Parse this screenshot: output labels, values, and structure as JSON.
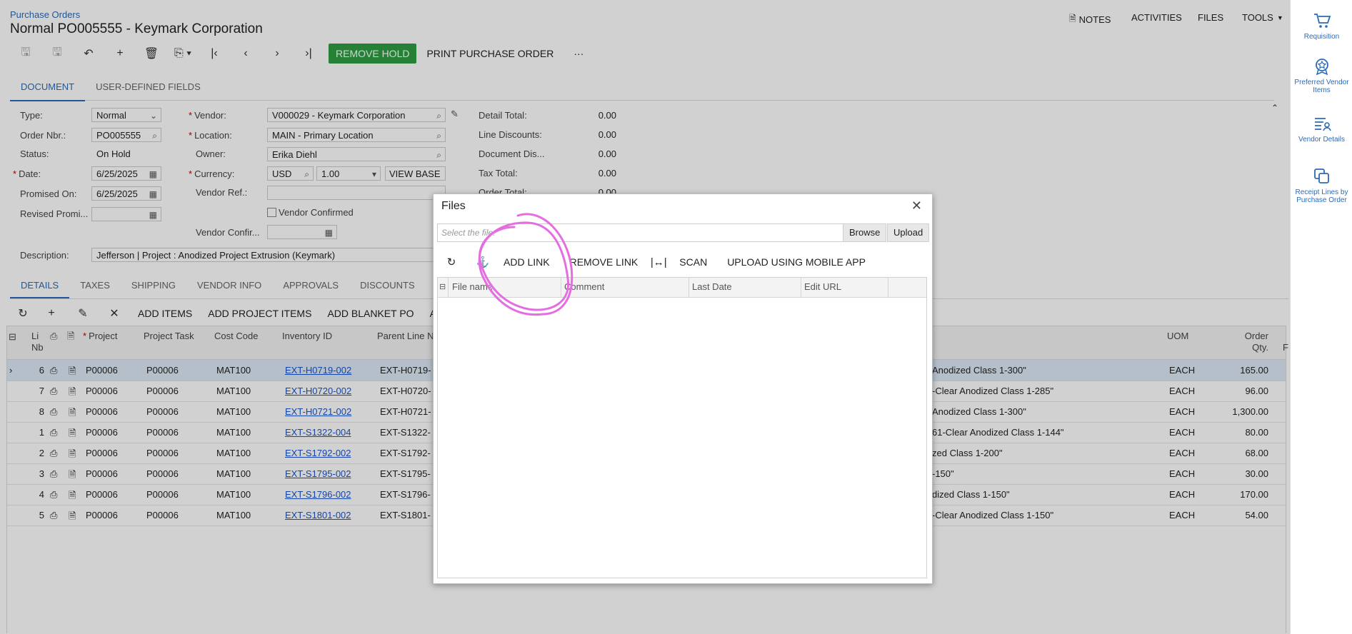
{
  "breadcrumb": "Purchase Orders",
  "title": "Normal PO005555 - Keymark Corporation",
  "top_actions": [
    "NOTES",
    "ACTIVITIES",
    "FILES",
    "TOOLS"
  ],
  "toolbar": {
    "remove_hold": "REMOVE HOLD",
    "print_po": "PRINT PURCHASE ORDER",
    "more": "···"
  },
  "main_tabs": [
    "DOCUMENT",
    "USER-DEFINED FIELDS"
  ],
  "form": {
    "type_label": "Type:",
    "type_value": "Normal",
    "order_label": "Order Nbr.:",
    "order_value": "PO005555",
    "status_label": "Status:",
    "status_value": "On Hold",
    "date_label": "Date:",
    "date_value": "6/25/2025",
    "promised_label": "Promised On:",
    "promised_value": "6/25/2025",
    "revised_label": "Revised Promi...",
    "revised_value": "",
    "vendor_label": "Vendor:",
    "vendor_value": "V000029 - Keymark Corporation",
    "location_label": "Location:",
    "location_value": "MAIN - Primary Location",
    "owner_label": "Owner:",
    "owner_value": "Erika Diehl",
    "currency_label": "Currency:",
    "currency_value": "USD",
    "rate_value": "1.00",
    "view_base": "VIEW BASE",
    "vendor_ref_label": "Vendor Ref.:",
    "vendor_ref_value": "",
    "vendor_confirmed_label": "Vendor Confirmed",
    "vendor_confir_label": "Vendor Confir...",
    "vendor_confir_value": "",
    "description_label": "Description:",
    "description_value": "Jefferson | Project : Anodized Project Extrusion (Keymark)",
    "detail_total_label": "Detail Total:",
    "detail_total_value": "0.00",
    "line_discounts_label": "Line Discounts:",
    "line_discounts_value": "0.00",
    "document_dis_label": "Document Dis...",
    "document_dis_value": "0.00",
    "tax_total_label": "Tax Total:",
    "tax_total_value": "0.00",
    "order_total_label": "Order Total:",
    "order_total_value": "0.00"
  },
  "detail_tabs": [
    "DETAILS",
    "TAXES",
    "SHIPPING",
    "VENDOR INFO",
    "APPROVALS",
    "DISCOUNTS"
  ],
  "grid_toolbar": [
    "ADD ITEMS",
    "ADD PROJECT ITEMS",
    "ADD BLANKET PO",
    "A"
  ],
  "grid_headers": {
    "line": "Li\nNb",
    "project": "Project",
    "task": "Project Task",
    "cost": "Cost Code",
    "inventory": "Inventory ID",
    "parent": "Parent Line N",
    "uom": "UOM",
    "qty": "Order\nQty.",
    "f": "F"
  },
  "rows": [
    {
      "line": "6",
      "project": "P00006",
      "task": "P00006",
      "cost": "MAT100",
      "inv": "EXT-H0719-002",
      "parent": "EXT-H0719-",
      "desc": "Anodized Class 1-300\"",
      "uom": "EACH",
      "qty": "165.00"
    },
    {
      "line": "7",
      "project": "P00006",
      "task": "P00006",
      "cost": "MAT100",
      "inv": "EXT-H0720-002",
      "parent": "EXT-H0720-",
      "desc": "-Clear Anodized Class 1-285\"",
      "uom": "EACH",
      "qty": "96.00"
    },
    {
      "line": "8",
      "project": "P00006",
      "task": "P00006",
      "cost": "MAT100",
      "inv": "EXT-H0721-002",
      "parent": "EXT-H0721-",
      "desc": "Anodized Class 1-300\"",
      "uom": "EACH",
      "qty": "1,300.00"
    },
    {
      "line": "1",
      "project": "P00006",
      "task": "P00006",
      "cost": "MAT100",
      "inv": "EXT-S1322-004",
      "parent": "EXT-S1322-",
      "desc": "61-Clear Anodized Class 1-144\"",
      "uom": "EACH",
      "qty": "80.00"
    },
    {
      "line": "2",
      "project": "P00006",
      "task": "P00006",
      "cost": "MAT100",
      "inv": "EXT-S1792-002",
      "parent": "EXT-S1792-",
      "desc": "zed Class 1-200\"",
      "uom": "EACH",
      "qty": "68.00"
    },
    {
      "line": "3",
      "project": "P00006",
      "task": "P00006",
      "cost": "MAT100",
      "inv": "EXT-S1795-002",
      "parent": "EXT-S1795-",
      "desc": "-150\"",
      "uom": "EACH",
      "qty": "30.00"
    },
    {
      "line": "4",
      "project": "P00006",
      "task": "P00006",
      "cost": "MAT100",
      "inv": "EXT-S1796-002",
      "parent": "EXT-S1796-",
      "desc": "dized Class 1-150\"",
      "uom": "EACH",
      "qty": "170.00"
    },
    {
      "line": "5",
      "project": "P00006",
      "task": "P00006",
      "cost": "MAT100",
      "inv": "EXT-S1801-002",
      "parent": "EXT-S1801-",
      "desc": "-Clear Anodized Class 1-150\"",
      "uom": "EACH",
      "qty": "54.00"
    }
  ],
  "right_sidebar": [
    "Requisition",
    "Preferred Vendor Items",
    "Vendor Details",
    "Receipt Lines by Purchase Order"
  ],
  "files_dialog": {
    "title": "Files",
    "file_placeholder": "Select the file.",
    "browse": "Browse",
    "upload": "Upload",
    "actions": [
      "ADD LINK",
      "REMOVE LINK",
      "SCAN",
      "UPLOAD USING MOBILE APP"
    ],
    "columns": [
      "File name",
      "Comment",
      "Last Date",
      "Edit URL"
    ]
  },
  "annotation_color": "#e46ee0",
  "accent_color": "#2a6cb8",
  "action_green": "#2f9e44"
}
